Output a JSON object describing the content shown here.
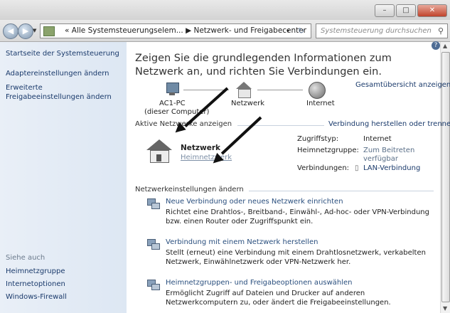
{
  "window": {
    "minimize": "–",
    "maximize": "□",
    "close": "✕"
  },
  "nav": {
    "back": "◀",
    "forward": "▶",
    "breadcrumb": "« Alle Systemsteuerungselem... ▶ Netzwerk- und Freigabecenter",
    "dropdown": "▾",
    "refresh": "↻",
    "search_placeholder": "Systemsteuerung durchsuchen"
  },
  "sidebar": {
    "home": "Startseite der Systemsteuerung",
    "adapter": "Adaptereinstellungen ändern",
    "advanced_line1": "Erweiterte",
    "advanced_line2": "Freigabeeinstellungen ändern",
    "see_also": "Siehe auch",
    "links": [
      "Heimnetzgruppe",
      "Internetoptionen",
      "Windows-Firewall"
    ]
  },
  "main": {
    "heading": "Zeigen Sie die grundlegenden Informationen zum Netzwerk an, und richten Sie Verbindungen ein.",
    "overview_link": "Gesamtübersicht anzeigen",
    "map": {
      "pc_name": "AC1-PC",
      "pc_sub": "(dieser Computer)",
      "network": "Netzwerk",
      "internet": "Internet"
    },
    "active_section": "Aktive Netzwerke anzeigen",
    "connect_link": "Verbindung herstellen oder trennen",
    "network_name": "Netzwerk",
    "network_type": "Heimnetzwerk",
    "details": {
      "access_label": "Zugriffstyp:",
      "access_value": "Internet",
      "homegroup_label": "Heimnetzgruppe:",
      "homegroup_value_1": "Zum Beitreten",
      "homegroup_value_2": "verfügbar",
      "connections_label": "Verbindungen:",
      "connections_value": "LAN-Verbindung"
    },
    "settings_section": "Netzwerkeinstellungen ändern",
    "tasks": [
      {
        "title": "Neue Verbindung oder neues Netzwerk einrichten",
        "desc": "Richtet eine Drahtlos-, Breitband-, Einwähl-, Ad-hoc- oder VPN-Verbindung bzw. einen Router oder Zugriffspunkt ein."
      },
      {
        "title": "Verbindung mit einem Netzwerk herstellen",
        "desc": "Stellt (erneut) eine Verbindung mit einem Drahtlosnetzwerk, verkabelten Netzwerk, Einwählnetzwerk oder VPN-Netzwerk her."
      },
      {
        "title": "Heimnetzgruppen- und Freigabeoptionen auswählen",
        "desc": "Ermöglicht Zugriff auf Dateien und Drucker auf anderen Netzwerkcomputern zu, oder ändert die Freigabeeinstellungen."
      }
    ]
  }
}
